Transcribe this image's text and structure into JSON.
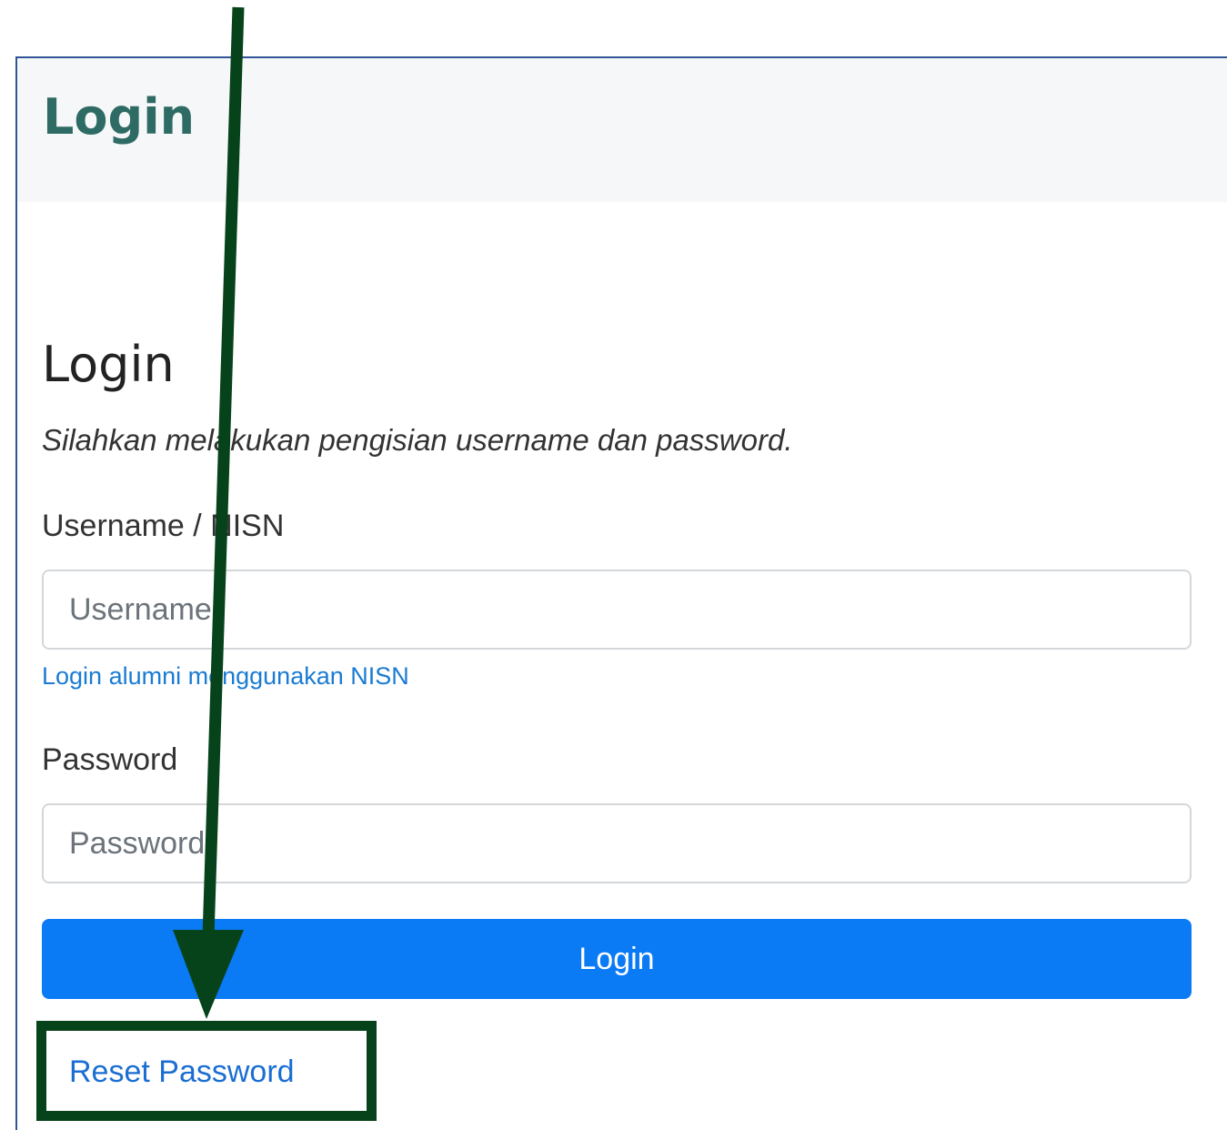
{
  "header": {
    "title": "Login"
  },
  "form": {
    "title": "Login",
    "subtitle": "Silahkan melakukan pengisian username dan password.",
    "username": {
      "label": "Username / NISN",
      "placeholder": "Username",
      "value": ""
    },
    "alumni_link": "Login alumni menggunakan NISN",
    "password": {
      "label": "Password",
      "placeholder": "Password",
      "value": ""
    },
    "login_button": "Login",
    "reset_link": "Reset Password"
  },
  "annotation": {
    "color": "#06421a",
    "type": "arrow-to-highlight-box"
  },
  "colors": {
    "header_title": "#2e6b64",
    "primary_button": "#0a7bf5",
    "link": "#1a7bd3",
    "card_border": "#2f5597"
  }
}
